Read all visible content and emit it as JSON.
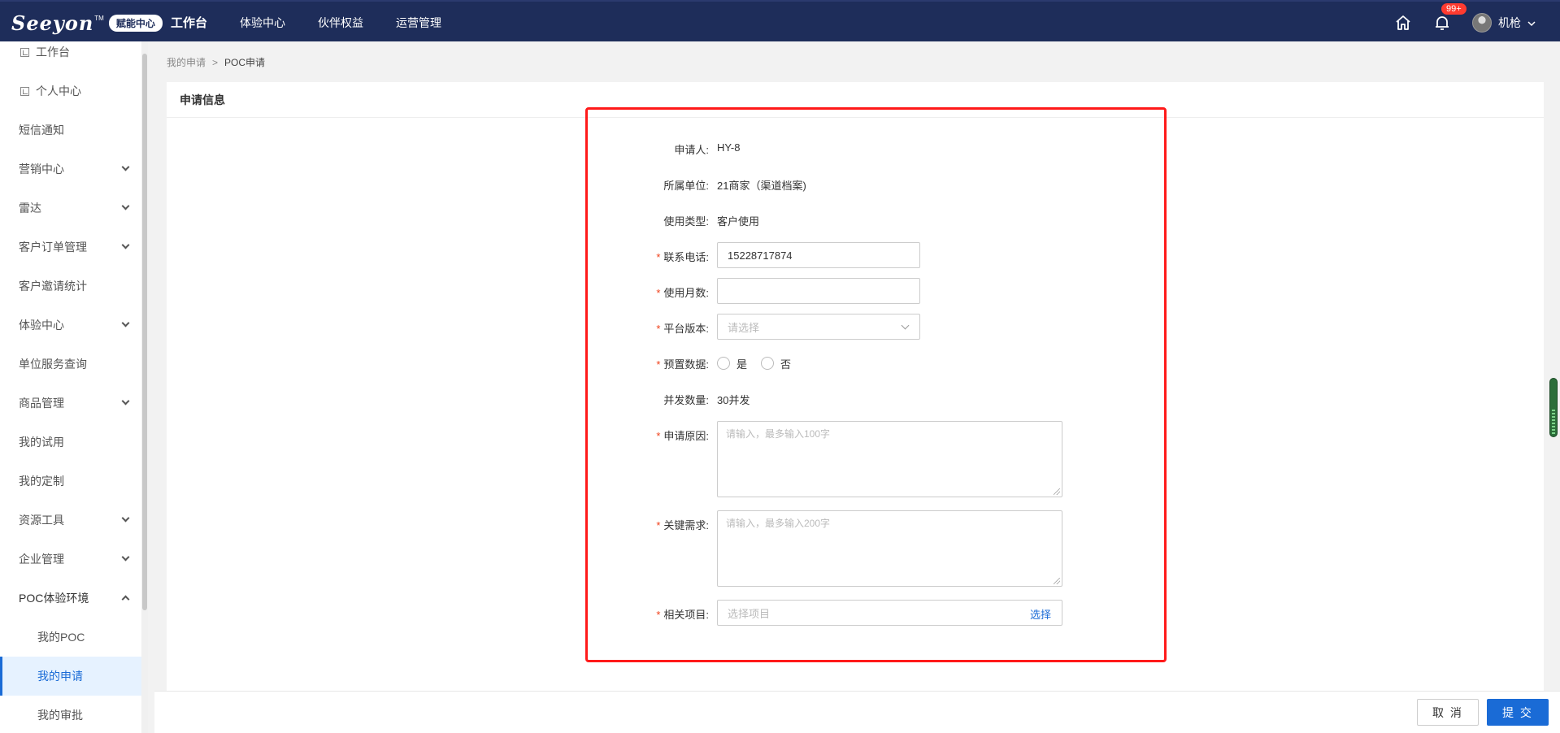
{
  "topbar": {
    "logo_text": "Seeyon",
    "logo_tm": "TM",
    "logo_badge": "赋能中心",
    "nav": [
      "工作台",
      "体验中心",
      "伙伴权益",
      "运营管理"
    ],
    "notification_count": "99+",
    "username": "机枪",
    "icons": {
      "home": "home-icon",
      "bell": "bell-icon",
      "dropdown": "chevron-down-icon"
    }
  },
  "sidebar": {
    "items": [
      {
        "label": "工作台"
      },
      {
        "label": "个人中心"
      },
      {
        "label": "短信通知"
      },
      {
        "label": "营销中心"
      },
      {
        "label": "雷达"
      },
      {
        "label": "客户订单管理"
      },
      {
        "label": "客户邀请统计"
      },
      {
        "label": "体验中心"
      },
      {
        "label": "单位服务查询"
      },
      {
        "label": "商品管理"
      },
      {
        "label": "我的试用"
      },
      {
        "label": "我的定制"
      },
      {
        "label": "资源工具"
      },
      {
        "label": "企业管理"
      },
      {
        "label": "POC体验环境"
      },
      {
        "label": "我的POC"
      },
      {
        "label": "我的申请"
      },
      {
        "label": "我的审批"
      }
    ]
  },
  "breadcrumb": {
    "parent": "我的申请",
    "separator": ">",
    "current": "POC申请"
  },
  "panel": {
    "title": "申请信息"
  },
  "form": {
    "applicant_label": "申请人:",
    "applicant_value": "HY-8",
    "unit_label": "所属单位:",
    "unit_value": "21商家（渠道档案)",
    "use_type_label": "使用类型:",
    "use_type_value": "客户使用",
    "phone_label": "联系电话:",
    "phone_value": "15228717874",
    "months_label": "使用月数:",
    "months_value": "",
    "version_label": "平台版本:",
    "version_placeholder": "请选择",
    "preset_label": "预置数据:",
    "preset_yes": "是",
    "preset_no": "否",
    "concurrency_label": "并发数量:",
    "concurrency_value": "30并发",
    "reason_label": "申请原因:",
    "reason_placeholder": "请输入，最多输入100字",
    "requirement_label": "关键需求:",
    "requirement_placeholder": "请输入，最多输入200字",
    "project_label": "相关项目:",
    "project_placeholder": "选择项目",
    "project_select": "选择",
    "required_mark": "*"
  },
  "footer": {
    "cancel": "取 消",
    "submit": "提 交"
  },
  "colors": {
    "topbar": "#1e2d5a",
    "accent": "#1a6bd6",
    "required": "#f0401a",
    "highlight": "#ff1a1a"
  }
}
